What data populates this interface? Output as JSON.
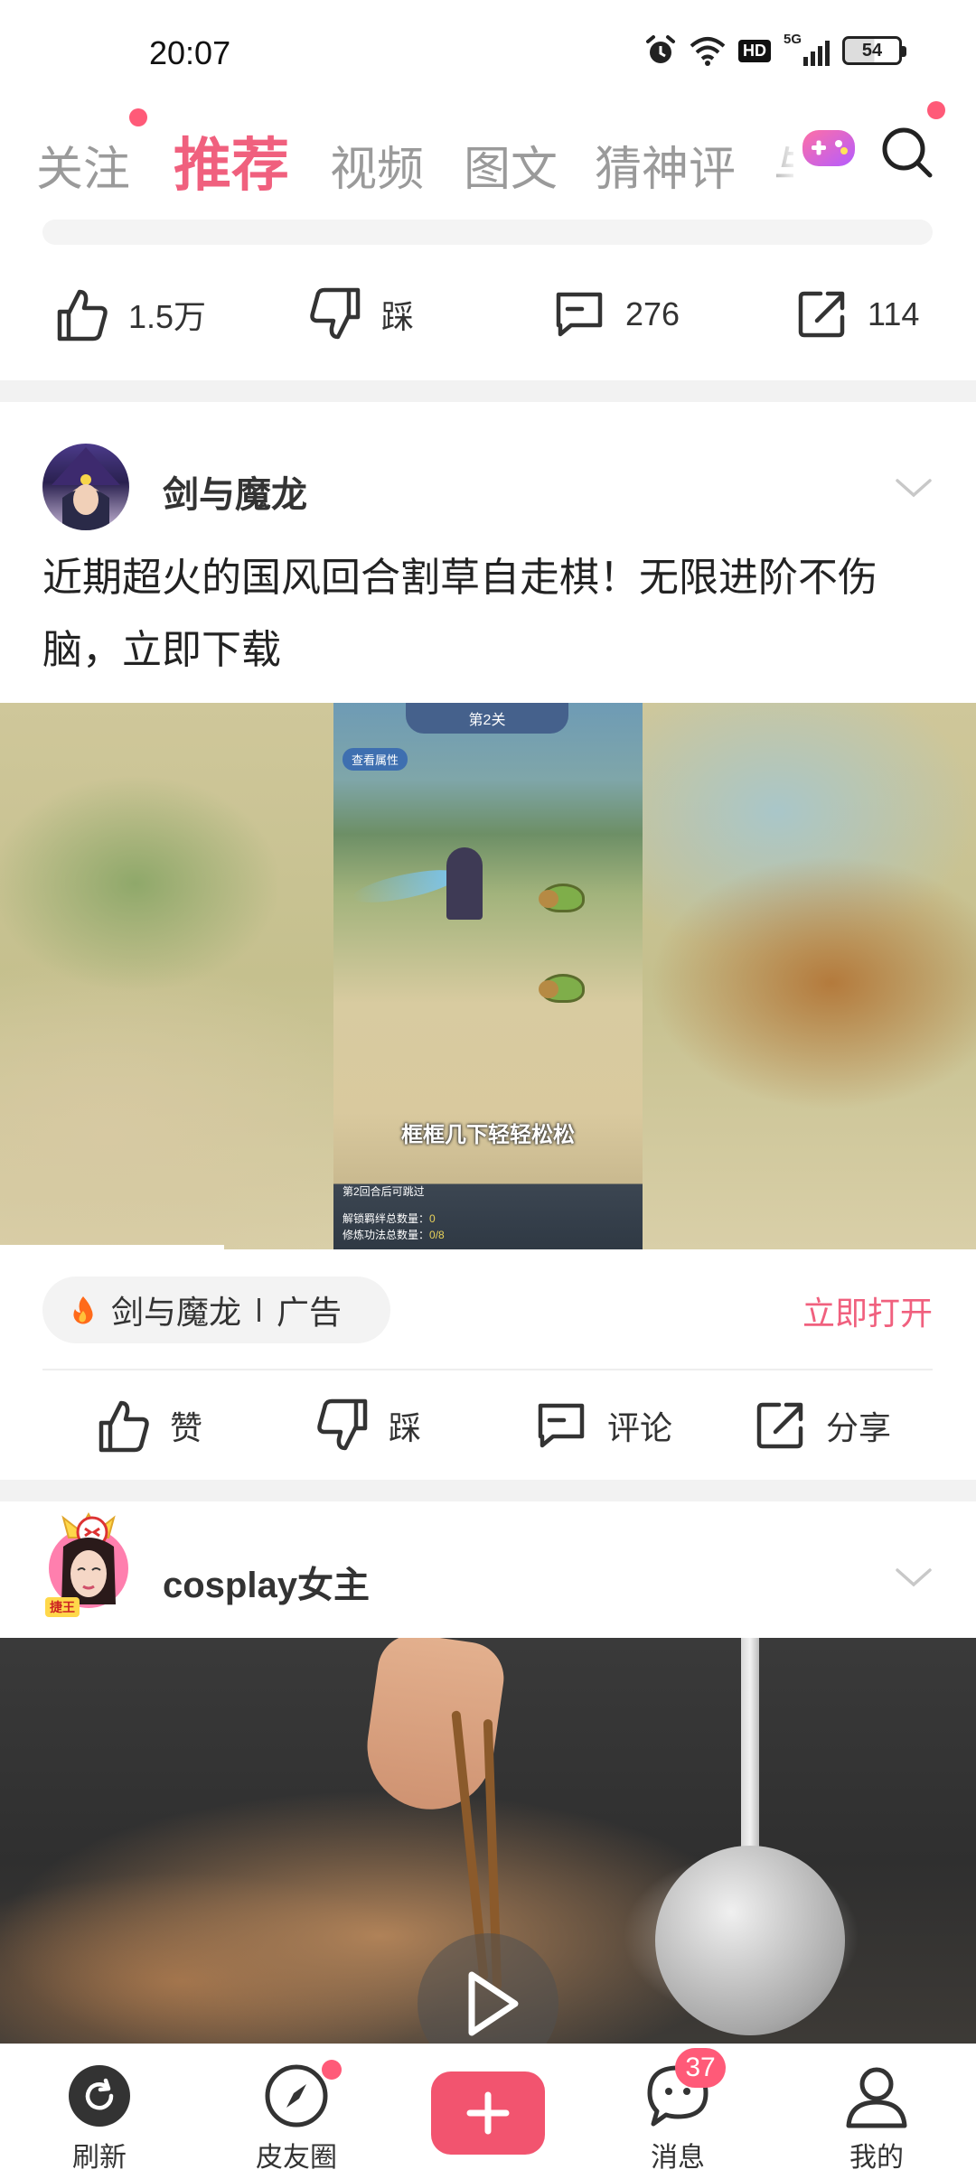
{
  "status_bar": {
    "time": "20:07",
    "network": "5G",
    "hd": "HD",
    "battery": "54"
  },
  "tabs": [
    {
      "label": "关注",
      "has_dot": true
    },
    {
      "label": "推荐",
      "active": true
    },
    {
      "label": "视频"
    },
    {
      "label": "图文"
    },
    {
      "label": "猜神评"
    },
    {
      "label": "与"
    }
  ],
  "header_icons": {
    "game": "game-controller-icon",
    "search": "search-icon",
    "search_has_dot": true
  },
  "post1_actions": {
    "like": "1.5万",
    "dislike": "踩",
    "comment": "276",
    "share": "114"
  },
  "ad_post": {
    "author": "剑与魔龙",
    "title": "近期超火的国风回合割草自走棋！无限进阶不伤脑，立即下载",
    "media": {
      "stage": "第2关",
      "attr_button": "查看属性",
      "caption": "框框几下轻轻松松",
      "round_note": "第2回合后可跳过",
      "unlock_label": "解锁羁绊总数量：",
      "unlock_value": "0",
      "skill_label": "修炼功法总数量：",
      "skill_value": "0/8"
    },
    "tag_name": "剑与魔龙",
    "tag_type": "广告",
    "open_label": "立即打开",
    "actions": {
      "like": "赞",
      "dislike": "踩",
      "comment": "评论",
      "share": "分享"
    }
  },
  "post3": {
    "author": "cosplay女主",
    "avatar_badge": "捷王"
  },
  "bottom_nav": {
    "refresh": "刷新",
    "circle": "皮友圈",
    "messages": "消息",
    "messages_badge": "37",
    "mine": "我的"
  },
  "colors": {
    "accent": "#f0607e",
    "badge": "#ff5a78",
    "add_button": "#f2546f"
  }
}
